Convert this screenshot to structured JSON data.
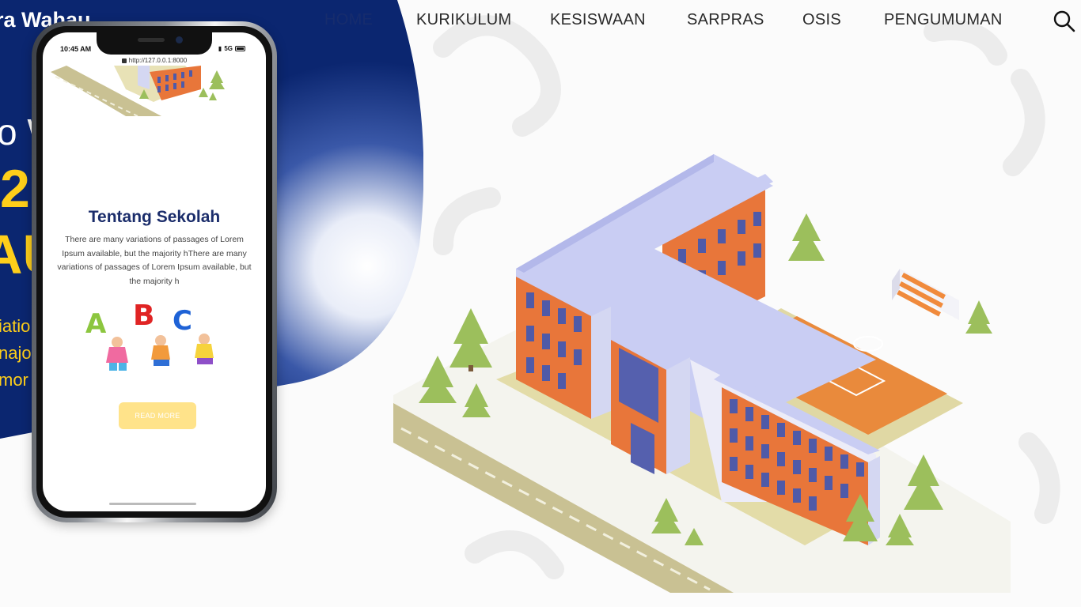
{
  "hero": {
    "brand_fragment": "ra Wahau",
    "greeting_fragment": "o W",
    "year_fragment": "2",
    "abbr_fragment": "AU",
    "desc_line1": "iatio                                   sum",
    "desc_line2": "najor                               in some",
    "desc_line3": "mor"
  },
  "nav": {
    "items": [
      "HOME",
      "KURIKULUM",
      "KESISWAAN",
      "SARPRAS",
      "OSIS",
      "PENGUMUMAN"
    ]
  },
  "phone": {
    "time": "10:45 AM",
    "network": "5G",
    "url": "http://127.0.0.1:8000",
    "section_title": "Tentang Sekolah",
    "section_text": "There are many variations of passages of Lorem Ipsum available, but the majority hThere are many variations of passages of Lorem Ipsum available, but the majority h",
    "button_label": "READ MORE"
  },
  "colors": {
    "navy": "#0b2670",
    "yellow": "#ffcf1a",
    "orange": "#e8763a",
    "roof": "#c9cdf3"
  }
}
